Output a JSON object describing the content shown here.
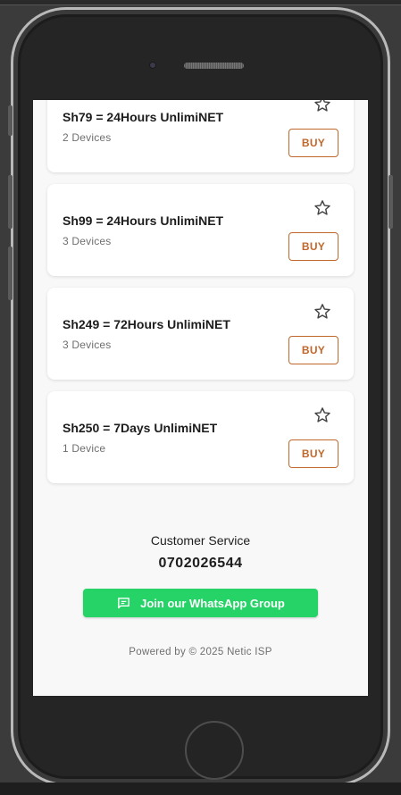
{
  "plans": [
    {
      "title": "Sh79 = 24Hours UnlimiNET",
      "devices": "2 Devices",
      "buy_label": "BUY",
      "favorite_icon": "star-outline-icon"
    },
    {
      "title": "Sh99 = 24Hours UnlimiNET",
      "devices": "3 Devices",
      "buy_label": "BUY",
      "favorite_icon": "star-outline-icon"
    },
    {
      "title": "Sh249 = 72Hours UnlimiNET",
      "devices": "3 Devices",
      "buy_label": "BUY",
      "favorite_icon": "star-outline-icon"
    },
    {
      "title": "Sh250 = 7Days UnlimiNET",
      "devices": "1 Device",
      "buy_label": "BUY",
      "favorite_icon": "star-outline-icon"
    }
  ],
  "customer_service": {
    "label": "Customer Service",
    "phone": "0702026544"
  },
  "whatsapp": {
    "label": "Join our WhatsApp Group",
    "icon": "chat-icon"
  },
  "footer": {
    "text": "Powered by © 2025 Netic ISP"
  },
  "colors": {
    "accent": "#c0672b",
    "whatsapp_green": "#25d366",
    "screen_bg": "#f8f8f8",
    "card_bg": "#ffffff"
  }
}
